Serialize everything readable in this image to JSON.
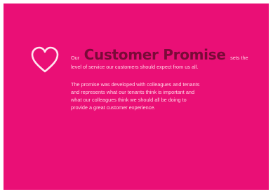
{
  "slide": {
    "background_color": "#ea0f76",
    "icon": "heart-outline-icon",
    "intro_prefix": "Our",
    "title": "Customer Promise",
    "intro_suffix": "sets the",
    "intro_line2": "level of service our customers should expect from us all.",
    "paragraph2": [
      "The promise was developed with colleagues and tenants",
      "and represents what our tenants think is important and",
      "what our colleagues think we should all be doing to",
      "provide a great customer experience."
    ]
  }
}
